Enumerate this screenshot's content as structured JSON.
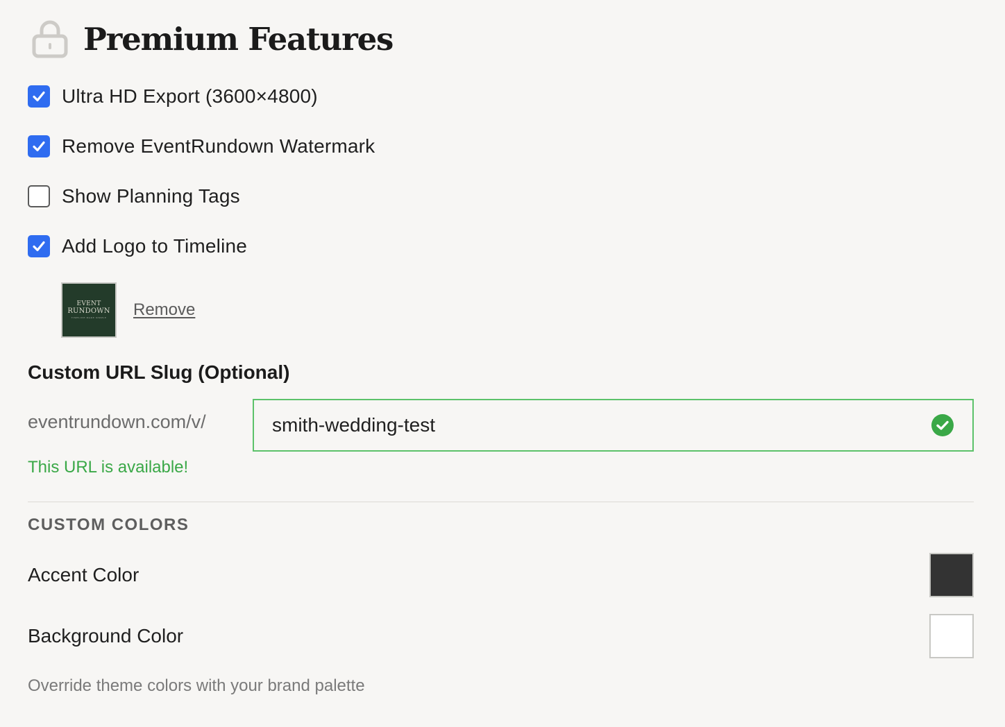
{
  "header": {
    "title": "Premium Features",
    "icon": "lock-icon"
  },
  "options": [
    {
      "label": "Ultra HD Export (3600×4800)",
      "checked": true
    },
    {
      "label": "Remove EventRundown Watermark",
      "checked": true
    },
    {
      "label": "Show Planning Tags",
      "checked": false
    },
    {
      "label": "Add Logo to Timeline",
      "checked": true
    }
  ],
  "logo": {
    "line1": "EVENT",
    "line2": "RUNDOWN",
    "line3": "TIMELINE MADE SIMPLE",
    "remove_label": "Remove"
  },
  "url_slug": {
    "label": "Custom URL Slug (Optional)",
    "prefix": "eventrundown.com/v/",
    "value": "smith-wedding-test",
    "status": "This URL is available!",
    "status_color": "#3aa847"
  },
  "custom_colors": {
    "heading": "CUSTOM COLORS",
    "accent_label": "Accent Color",
    "accent_value": "#333333",
    "background_label": "Background Color",
    "background_value": "#ffffff",
    "helper": "Override theme colors with your brand palette"
  },
  "colors": {
    "checkbox_accent": "#2f6cf0",
    "valid_border": "#5cc26a"
  }
}
